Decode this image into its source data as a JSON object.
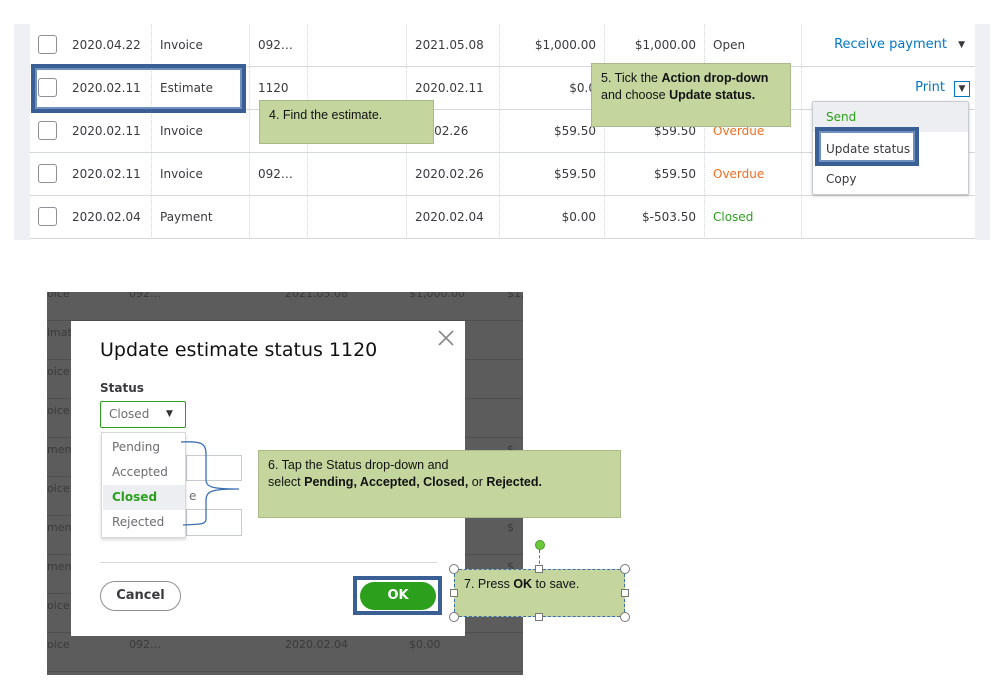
{
  "table": {
    "rows": [
      {
        "date": "2020.04.22",
        "type": "Invoice",
        "no": "092…",
        "due": "2021.05.08",
        "amount": "$1,000.00",
        "balance": "$1,000.00",
        "status": "Open",
        "status_kind": "open",
        "action": "Receive payment"
      },
      {
        "date": "2020.02.11",
        "type": "Estimate",
        "no": "1120",
        "due": "2020.02.11",
        "amount": "$0.0",
        "balance": "",
        "status": "",
        "status_kind": "open",
        "action": "Print"
      },
      {
        "date": "2020.02.11",
        "type": "Invoice",
        "no": "",
        "due": "20.02.26",
        "amount": "$59.50",
        "balance": "$59.50",
        "status": "Overdue",
        "status_kind": "overdue",
        "action": ""
      },
      {
        "date": "2020.02.11",
        "type": "Invoice",
        "no": "092…",
        "due": "2020.02.26",
        "amount": "$59.50",
        "balance": "$59.50",
        "status": "Overdue",
        "status_kind": "overdue",
        "action": ""
      },
      {
        "date": "2020.02.04",
        "type": "Payment",
        "no": "",
        "due": "2020.02.04",
        "amount": "$0.00",
        "balance": "$-503.50",
        "status": "Closed",
        "status_kind": "closed",
        "action": ""
      }
    ]
  },
  "action_menu": {
    "items": [
      "Send",
      "Update status",
      "Copy"
    ]
  },
  "callouts": {
    "c4": "4. Find the estimate.",
    "c5_a": "5. Tick the ",
    "c5_b": "Action drop-down",
    "c5_c": " and choose ",
    "c5_d": "Update status.",
    "c6_a": "6. Tap the Status drop-down and",
    "c6_b": "select ",
    "c6_c": "Pending, Accepted, Closed,",
    "c6_d": " or ",
    "c6_e": "Rejected.",
    "c7_a": "7. Press ",
    "c7_b": "OK",
    "c7_c": " to save."
  },
  "background_rows": [
    {
      "a": "oice",
      "b": "092…",
      "c": "2021.05.08",
      "d": "$1,000.00",
      "e": "$1,"
    },
    {
      "a": "imat",
      "b": "",
      "c": "",
      "d": "",
      "e": ""
    },
    {
      "a": "oice",
      "b": "",
      "c": "",
      "d": "",
      "e": ""
    },
    {
      "a": "oice",
      "b": "",
      "c": "",
      "d": "",
      "e": ""
    },
    {
      "a": "men",
      "b": "",
      "c": "",
      "d": "",
      "e": "$"
    },
    {
      "a": "oice",
      "b": "",
      "c": "",
      "d": "",
      "e": ""
    },
    {
      "a": "men",
      "b": "",
      "c": "",
      "d": "",
      "e": "$"
    },
    {
      "a": "men",
      "b": "",
      "c": "",
      "d": "",
      "e": "$"
    },
    {
      "a": "oice",
      "b": "",
      "c": "",
      "d": "",
      "e": ""
    },
    {
      "a": "oice",
      "b": "092…",
      "c": "2020.02.04",
      "d": "$0.00",
      "e": ""
    }
  ],
  "modal": {
    "title": "Update estimate status 1120",
    "status_label": "Status",
    "status_value": "Closed",
    "options": [
      "Pending",
      "Accepted",
      "Closed",
      "Rejected"
    ],
    "selected": "Closed",
    "hidden_field_fragment": "e",
    "cancel": "Cancel",
    "ok": "OK"
  },
  "colors": {
    "accent_green": "#2ca01c",
    "link_blue": "#0077c5",
    "overdue": "#f26c21",
    "callout": "#c4d69e",
    "highlight": "#3a5f94"
  }
}
